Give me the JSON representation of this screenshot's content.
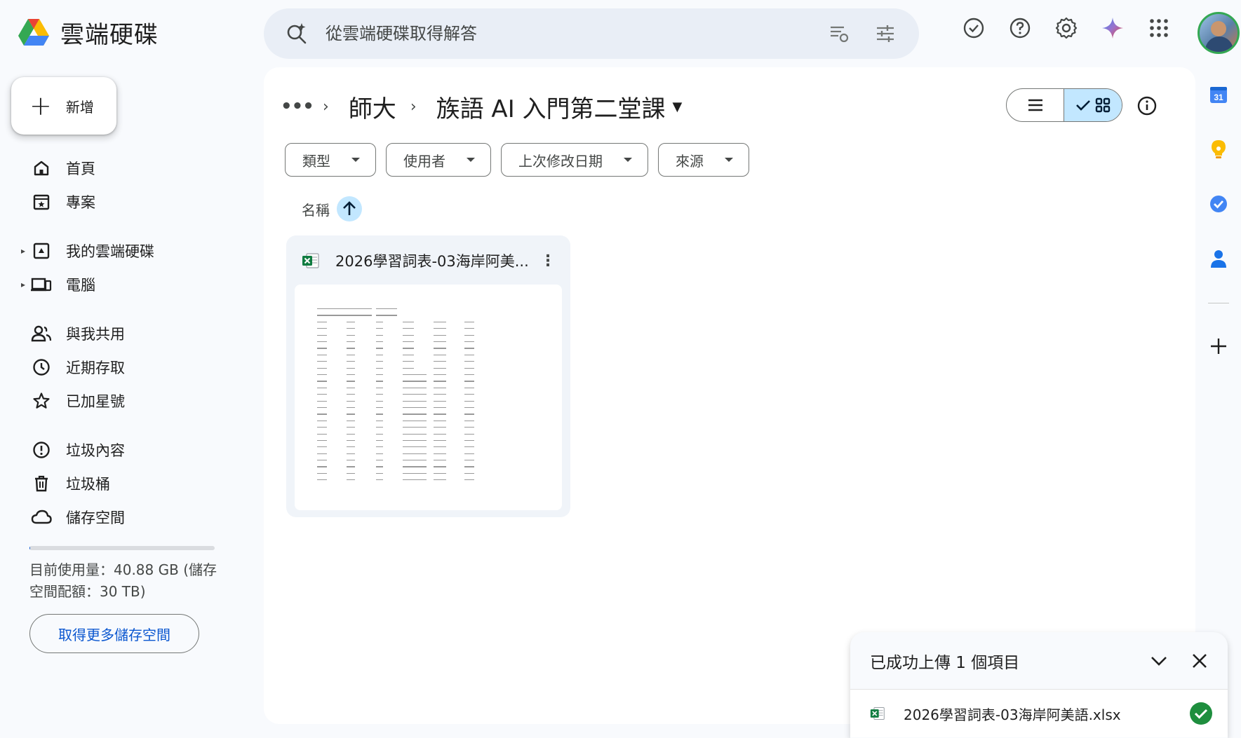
{
  "app": {
    "name": "雲端硬碟"
  },
  "search": {
    "placeholder": "從雲端硬碟取得解答"
  },
  "sidebar": {
    "new_label": "新增",
    "items": [
      {
        "label": "首頁",
        "icon": "home-icon"
      },
      {
        "label": "專案",
        "icon": "projects-icon"
      },
      {
        "label": "我的雲端硬碟",
        "icon": "my-drive-icon"
      },
      {
        "label": "電腦",
        "icon": "computers-icon"
      },
      {
        "label": "與我共用",
        "icon": "shared-icon"
      },
      {
        "label": "近期存取",
        "icon": "recent-icon"
      },
      {
        "label": "已加星號",
        "icon": "star-icon"
      },
      {
        "label": "垃圾內容",
        "icon": "spam-icon"
      },
      {
        "label": "垃圾桶",
        "icon": "trash-icon"
      },
      {
        "label": "儲存空間",
        "icon": "cloud-icon"
      }
    ],
    "storage_text": "目前使用量：40.88 GB (儲存空間配額：30 TB)",
    "storage_fraction": 0.0014,
    "more_storage_label": "取得更多儲存空間"
  },
  "breadcrumb": {
    "more": "•••",
    "parent": "師大",
    "current": "族語 AI 入門第二堂課"
  },
  "filters": [
    "類型",
    "使用者",
    "上次修改日期",
    "來源"
  ],
  "sort": {
    "label": "名稱",
    "direction": "ascending"
  },
  "files": [
    {
      "title": "2026學習詞表-03海岸阿美...",
      "type": "xlsx"
    }
  ],
  "toast": {
    "title": "已成功上傳 1 個項目",
    "file_name": "2026學習詞表-03海岸阿美語.xlsx",
    "status": "complete"
  },
  "right_rail": {
    "calendar_day": "31",
    "items": [
      "calendar-icon",
      "keep-icon",
      "tasks-icon",
      "contacts-icon",
      "add-icon"
    ]
  },
  "colors": {
    "accent": "#0b57d0",
    "selected": "#c2e7ff",
    "surface": "#f8fafd",
    "success": "#1e8e3e"
  }
}
